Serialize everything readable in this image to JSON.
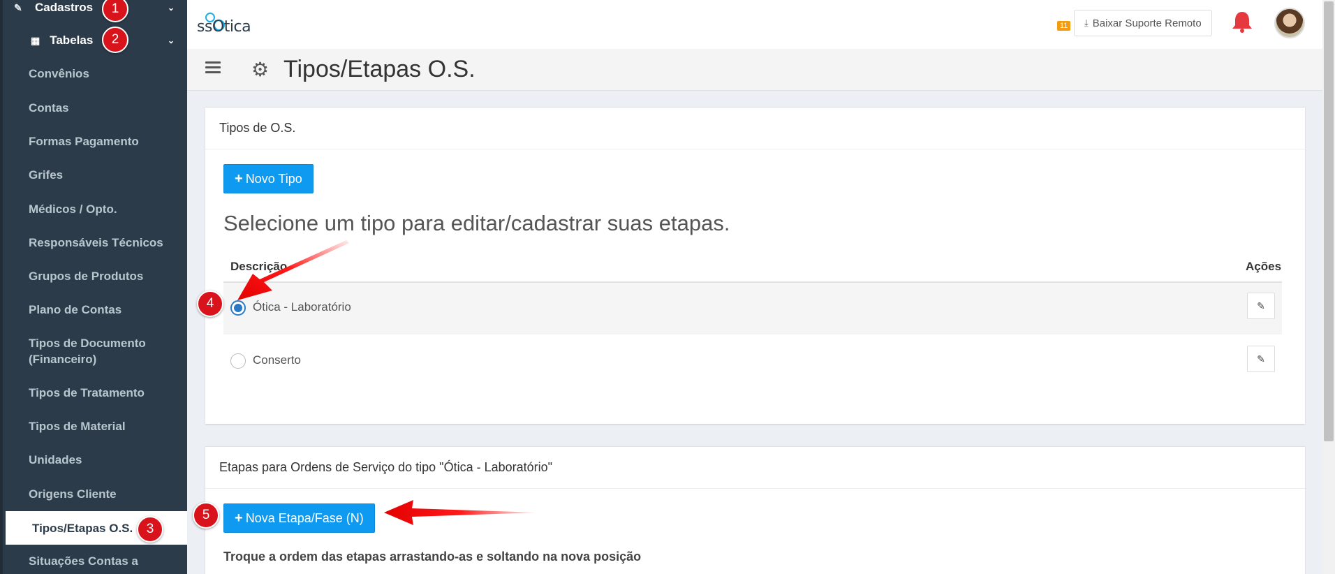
{
  "sidebar": {
    "section_title": "Cadastros",
    "subsection_title": "Tabelas",
    "items": [
      {
        "label": "Convênios"
      },
      {
        "label": "Contas"
      },
      {
        "label": "Formas Pagamento"
      },
      {
        "label": "Grifes"
      },
      {
        "label": "Médicos / Opto."
      },
      {
        "label": "Responsáveis Técnicos"
      },
      {
        "label": "Grupos de Produtos"
      },
      {
        "label": "Plano de Contas"
      },
      {
        "label": "Tipos de Documento (Financeiro)"
      },
      {
        "label": "Tipos de Tratamento"
      },
      {
        "label": "Tipos de Material"
      },
      {
        "label": "Unidades"
      },
      {
        "label": "Origens Cliente"
      },
      {
        "label": "Tipos/Etapas O.S."
      },
      {
        "label": "Situações Contas a"
      }
    ],
    "active_item": "Tipos/Etapas O.S."
  },
  "header": {
    "logo_text": "ssOtica",
    "remote_support_label": "Baixar Suporte Remoto",
    "notification_count": "11"
  },
  "page": {
    "title": "Tipos/Etapas O.S."
  },
  "types_box": {
    "title": "Tipos de O.S.",
    "new_button_label": "Novo Tipo",
    "hint": "Selecione um tipo para editar/cadastrar suas etapas.",
    "columns": {
      "description": "Descrição",
      "actions": "Ações"
    },
    "rows": [
      {
        "label": "Ótica - Laboratório",
        "selected": true
      },
      {
        "label": "Conserto",
        "selected": false
      }
    ]
  },
  "steps_box": {
    "title": "Etapas para Ordens de Serviço do tipo \"Ótica - Laboratório\"",
    "new_button_label": "Nova Etapa/Fase (N)",
    "reorder_hint": "Troque a ordem das etapas arrastando-as e soltando na nova posição"
  },
  "annotations": {
    "step1": "1",
    "step2": "2",
    "step3": "3",
    "step4": "4",
    "step5": "5"
  },
  "colors": {
    "sidebar_bg": "#2c3b4a",
    "primary_button": "#0e9af0",
    "annotation_red": "#d9131b"
  }
}
